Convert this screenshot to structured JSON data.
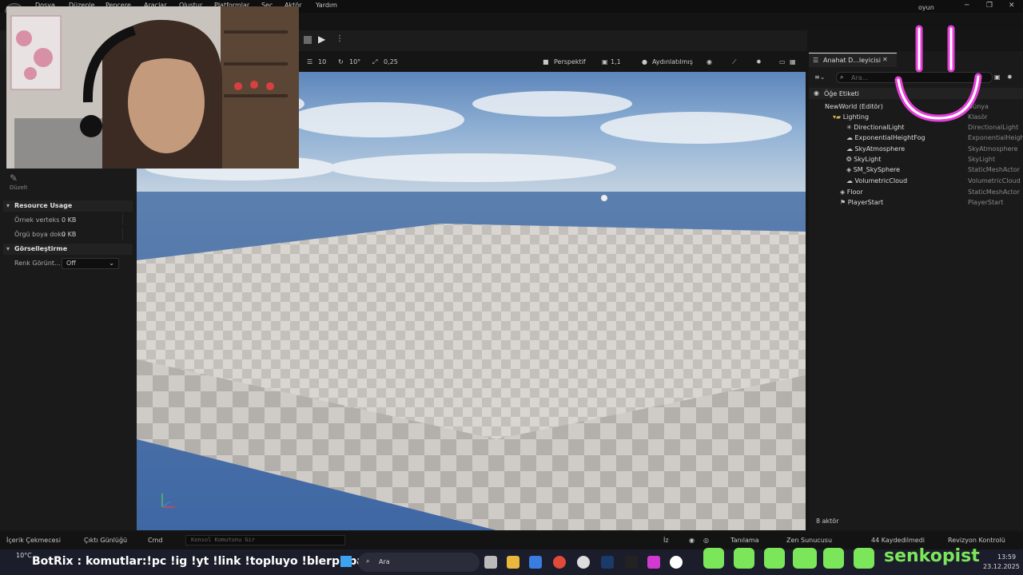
{
  "menu": {
    "items": [
      "Dosya",
      "Düzenle",
      "Pencere",
      "Araçlar",
      "Oluştur",
      "Platformlar",
      "Seç",
      "Aktör",
      "Yardım"
    ],
    "project": "oyun"
  },
  "left_panel": {
    "edit_tool_label": "Düzelt",
    "sections": [
      {
        "title": "Resource Usage",
        "props": [
          {
            "label": "Örnek verteks",
            "value": "0 KB"
          },
          {
            "label": "Örgü boya doku",
            "value": "0 KB"
          }
        ]
      },
      {
        "title": "Görselleştirme",
        "props": [
          {
            "label": "Renk Görünt...",
            "value": "Off"
          }
        ]
      }
    ]
  },
  "viewport_toolbar": {
    "grid": "10",
    "rot": "10°",
    "scale": "0,25",
    "view": "Perspektif",
    "lit": "Aydınlatılmış",
    "speed": "1,1"
  },
  "outliner": {
    "tab": "Anahat D...leyicisi",
    "search_placeholder": "Ara...",
    "header": "Öğe Etiketi",
    "items": [
      {
        "label": "NewWorld (Editör)",
        "type": "Dünya"
      },
      {
        "label": "Lighting",
        "type": "Klasör"
      },
      {
        "label": "DirectionalLight",
        "type": "DirectionalLight"
      },
      {
        "label": "ExponentialHeightFog",
        "type": "ExponentialHeigh"
      },
      {
        "label": "SkyAtmosphere",
        "type": "SkyAtmosphere"
      },
      {
        "label": "SkyLight",
        "type": "SkyLight"
      },
      {
        "label": "SM_SkySphere",
        "type": "StaticMeshActor"
      },
      {
        "label": "VolumetricCloud",
        "type": "VolumetricCloud"
      },
      {
        "label": "Floor",
        "type": "StaticMeshActor"
      },
      {
        "label": "PlayerStart",
        "type": "PlayerStart"
      }
    ],
    "footer": "8 aktör"
  },
  "statusbar": {
    "content_drawer": "İçerik Çekmecesi",
    "output_log": "Çıktı Günlüğü",
    "cmd": "Cmd",
    "cmd_placeholder": "Konsol Komutunu Gir",
    "trace": "İz",
    "diagnose": "Tanılama",
    "zen": "Zen Sunucusu",
    "unsaved": "44 Kaydedilmedi",
    "revision": "Revizyon Kontrolü"
  },
  "taskbar": {
    "weather_temp": "10°C",
    "bot_text": "BotRix : komutlar:!pc !ig !yt !link !topluyo !blerp !bağış",
    "search": "Ara",
    "brand": "senkopist",
    "time": "13:59",
    "date": "23.12.2025"
  },
  "colors": {
    "accent_pink": "#e43fd8",
    "social_green": "#7be65a",
    "ue_panel": "#1a1a1a",
    "sky": "#6f98c8",
    "floor": "#d8d4cf"
  }
}
